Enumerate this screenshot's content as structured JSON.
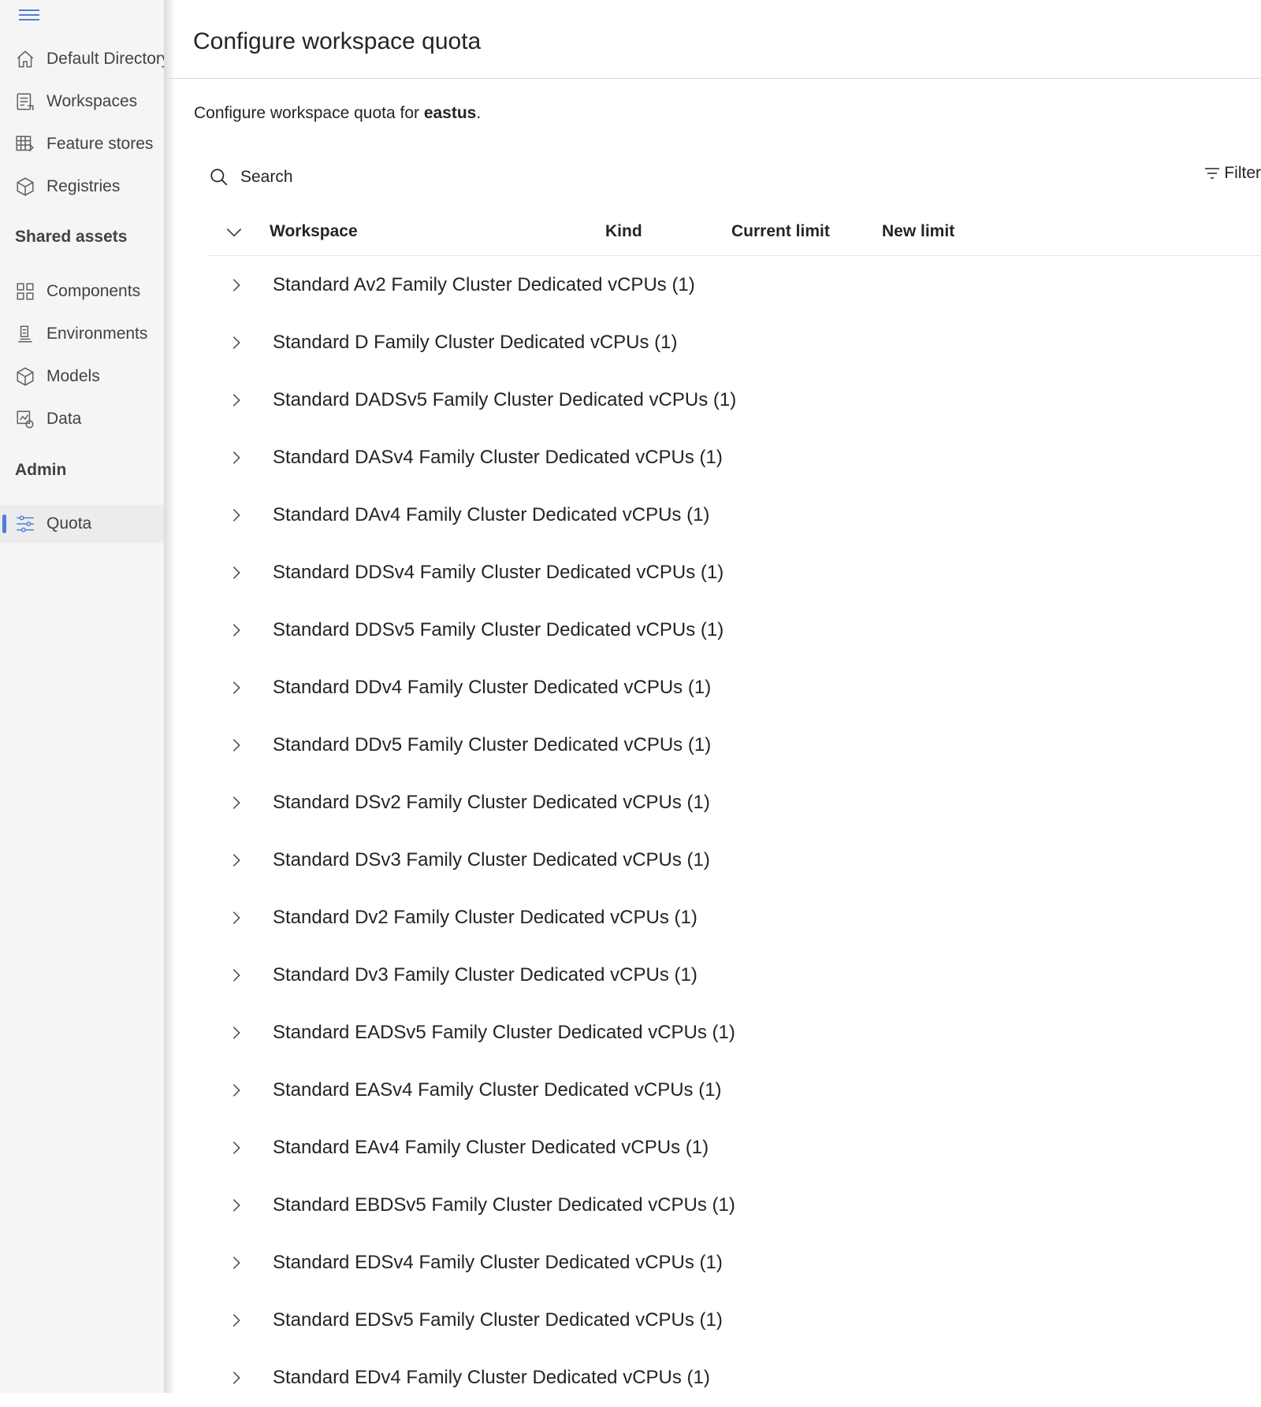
{
  "sidebar": {
    "items": [
      {
        "label": "Default Directory",
        "icon": "home-icon"
      },
      {
        "label": "Workspaces",
        "icon": "workspaces-icon"
      },
      {
        "label": "Feature stores",
        "icon": "feature-store-icon"
      },
      {
        "label": "Registries",
        "icon": "registry-icon"
      }
    ],
    "shared_title": "Shared assets",
    "shared_items": [
      {
        "label": "Components",
        "icon": "components-icon"
      },
      {
        "label": "Environments",
        "icon": "environments-icon"
      },
      {
        "label": "Models",
        "icon": "models-icon"
      },
      {
        "label": "Data",
        "icon": "data-icon"
      }
    ],
    "admin_title": "Admin",
    "admin_items": [
      {
        "label": "Quota",
        "icon": "quota-icon",
        "active": true
      }
    ],
    "accent_color": "#4f7fd6"
  },
  "main": {
    "title": "Configure workspace quota",
    "subtitle_prefix": "Configure workspace quota for ",
    "region": "eastus",
    "subtitle_suffix": ".",
    "search_placeholder": "Search",
    "filter_label": "Filter",
    "columns": [
      "Workspace",
      "Kind",
      "Current limit",
      "New limit"
    ],
    "rows": [
      "Standard Av2 Family Cluster Dedicated vCPUs (1)",
      "Standard D Family Cluster Dedicated vCPUs (1)",
      "Standard DADSv5 Family Cluster Dedicated vCPUs (1)",
      "Standard DASv4 Family Cluster Dedicated vCPUs (1)",
      "Standard DAv4 Family Cluster Dedicated vCPUs (1)",
      "Standard DDSv4 Family Cluster Dedicated vCPUs (1)",
      "Standard DDSv5 Family Cluster Dedicated vCPUs (1)",
      "Standard DDv4 Family Cluster Dedicated vCPUs (1)",
      "Standard DDv5 Family Cluster Dedicated vCPUs (1)",
      "Standard DSv2 Family Cluster Dedicated vCPUs (1)",
      "Standard DSv3 Family Cluster Dedicated vCPUs (1)",
      "Standard Dv2 Family Cluster Dedicated vCPUs (1)",
      "Standard Dv3 Family Cluster Dedicated vCPUs (1)",
      "Standard EADSv5 Family Cluster Dedicated vCPUs (1)",
      "Standard EASv4 Family Cluster Dedicated vCPUs (1)",
      "Standard EAv4 Family Cluster Dedicated vCPUs (1)",
      "Standard EBDSv5 Family Cluster Dedicated vCPUs (1)",
      "Standard EDSv4 Family Cluster Dedicated vCPUs (1)",
      "Standard EDSv5 Family Cluster Dedicated vCPUs (1)",
      "Standard EDv4 Family Cluster Dedicated vCPUs (1)"
    ]
  }
}
